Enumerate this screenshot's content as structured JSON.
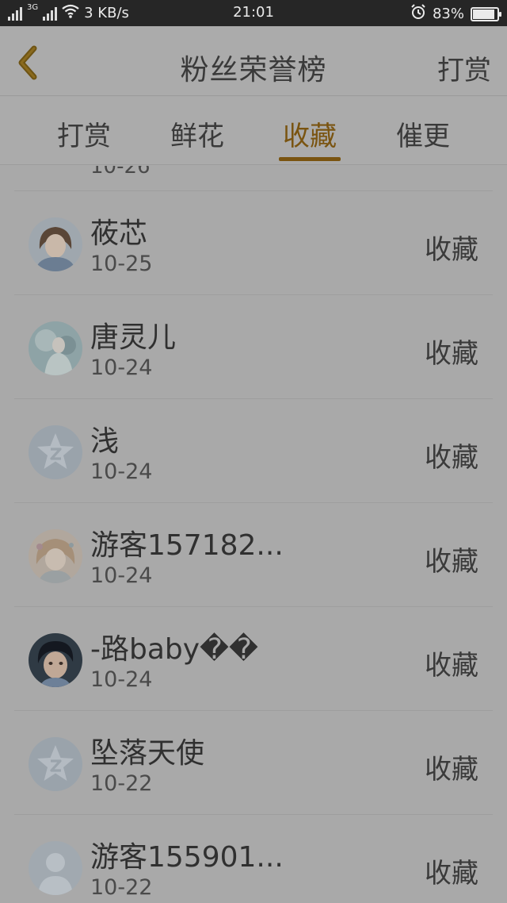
{
  "status_bar": {
    "network_type": "3G",
    "speed": "3 KB/s",
    "time": "21:01",
    "battery": "83%"
  },
  "header": {
    "title": "粉丝荣誉榜",
    "right_action": "打赏"
  },
  "tabs": [
    {
      "label": "打赏",
      "active": false
    },
    {
      "label": "鲜花",
      "active": false
    },
    {
      "label": "收藏",
      "active": true
    },
    {
      "label": "催更",
      "active": false
    }
  ],
  "list": {
    "partial_top_date": "10-26",
    "items": [
      {
        "name": "莜芯",
        "date": "10-25",
        "action": "收藏",
        "avatar": "avatar-girl-illustration"
      },
      {
        "name": "唐灵儿",
        "date": "10-24",
        "action": "收藏",
        "avatar": "avatar-fantasy-illustration"
      },
      {
        "name": "浅",
        "date": "10-24",
        "action": "收藏",
        "avatar": "avatar-default-star"
      },
      {
        "name": "游客157182...",
        "date": "10-24",
        "action": "收藏",
        "avatar": "avatar-anime-girl"
      },
      {
        "name": "-路baby��",
        "date": "10-24",
        "action": "收藏",
        "avatar": "avatar-boy-photo"
      },
      {
        "name": "坠落天使",
        "date": "10-22",
        "action": "收藏",
        "avatar": "avatar-default-star"
      },
      {
        "name": "游客155901...",
        "date": "10-22",
        "action": "收藏",
        "avatar": "avatar-default-person"
      }
    ]
  },
  "colors": {
    "accent": "#7a5410",
    "background": "#a9a9a9",
    "status_bar": "#262626"
  }
}
